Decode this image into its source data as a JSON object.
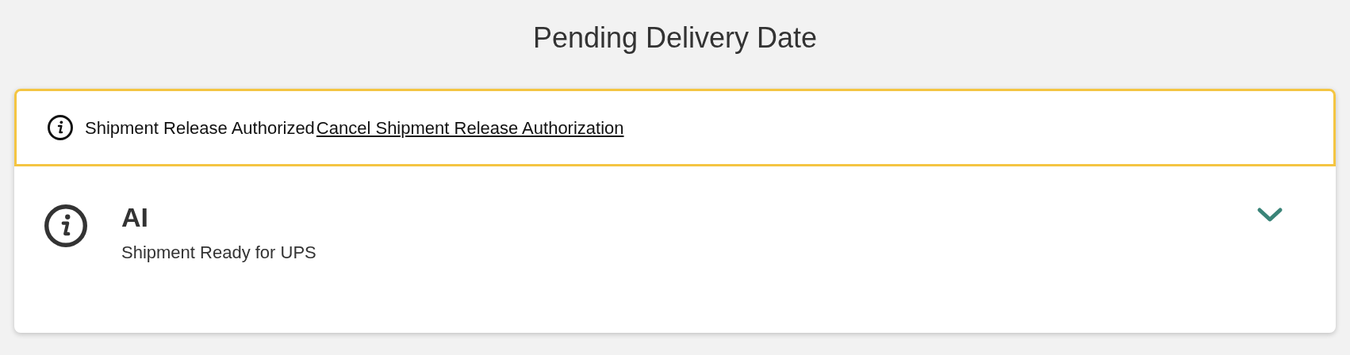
{
  "title": "Pending Delivery Date",
  "banner": {
    "message": "Shipment Release Authorized",
    "link": "Cancel Shipment Release Authorization"
  },
  "item": {
    "title": "AI",
    "subtitle": "Shipment Ready for UPS",
    "expanded": false
  }
}
